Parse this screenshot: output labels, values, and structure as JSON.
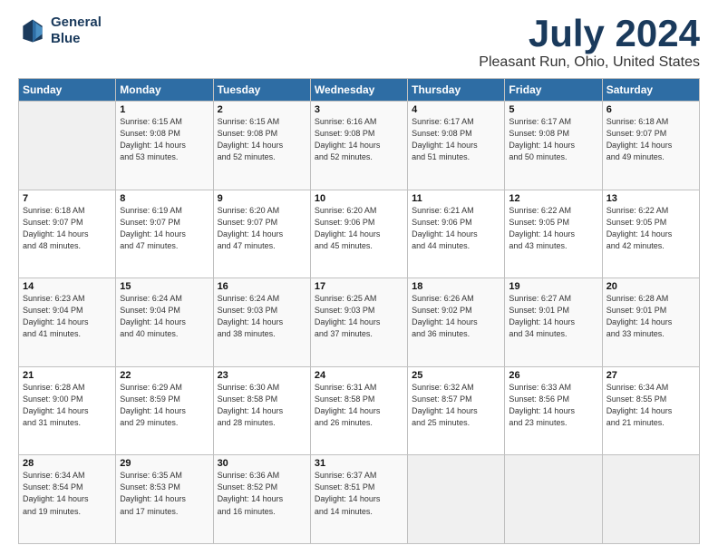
{
  "logo": {
    "line1": "General",
    "line2": "Blue"
  },
  "title": "July 2024",
  "location": "Pleasant Run, Ohio, United States",
  "days_of_week": [
    "Sunday",
    "Monday",
    "Tuesday",
    "Wednesday",
    "Thursday",
    "Friday",
    "Saturday"
  ],
  "weeks": [
    [
      {
        "day": "",
        "sunrise": "",
        "sunset": "",
        "daylight": ""
      },
      {
        "day": "1",
        "sunrise": "Sunrise: 6:15 AM",
        "sunset": "Sunset: 9:08 PM",
        "daylight": "Daylight: 14 hours and 53 minutes."
      },
      {
        "day": "2",
        "sunrise": "Sunrise: 6:15 AM",
        "sunset": "Sunset: 9:08 PM",
        "daylight": "Daylight: 14 hours and 52 minutes."
      },
      {
        "day": "3",
        "sunrise": "Sunrise: 6:16 AM",
        "sunset": "Sunset: 9:08 PM",
        "daylight": "Daylight: 14 hours and 52 minutes."
      },
      {
        "day": "4",
        "sunrise": "Sunrise: 6:17 AM",
        "sunset": "Sunset: 9:08 PM",
        "daylight": "Daylight: 14 hours and 51 minutes."
      },
      {
        "day": "5",
        "sunrise": "Sunrise: 6:17 AM",
        "sunset": "Sunset: 9:08 PM",
        "daylight": "Daylight: 14 hours and 50 minutes."
      },
      {
        "day": "6",
        "sunrise": "Sunrise: 6:18 AM",
        "sunset": "Sunset: 9:07 PM",
        "daylight": "Daylight: 14 hours and 49 minutes."
      }
    ],
    [
      {
        "day": "7",
        "sunrise": "Sunrise: 6:18 AM",
        "sunset": "Sunset: 9:07 PM",
        "daylight": "Daylight: 14 hours and 48 minutes."
      },
      {
        "day": "8",
        "sunrise": "Sunrise: 6:19 AM",
        "sunset": "Sunset: 9:07 PM",
        "daylight": "Daylight: 14 hours and 47 minutes."
      },
      {
        "day": "9",
        "sunrise": "Sunrise: 6:20 AM",
        "sunset": "Sunset: 9:07 PM",
        "daylight": "Daylight: 14 hours and 47 minutes."
      },
      {
        "day": "10",
        "sunrise": "Sunrise: 6:20 AM",
        "sunset": "Sunset: 9:06 PM",
        "daylight": "Daylight: 14 hours and 45 minutes."
      },
      {
        "day": "11",
        "sunrise": "Sunrise: 6:21 AM",
        "sunset": "Sunset: 9:06 PM",
        "daylight": "Daylight: 14 hours and 44 minutes."
      },
      {
        "day": "12",
        "sunrise": "Sunrise: 6:22 AM",
        "sunset": "Sunset: 9:05 PM",
        "daylight": "Daylight: 14 hours and 43 minutes."
      },
      {
        "day": "13",
        "sunrise": "Sunrise: 6:22 AM",
        "sunset": "Sunset: 9:05 PM",
        "daylight": "Daylight: 14 hours and 42 minutes."
      }
    ],
    [
      {
        "day": "14",
        "sunrise": "Sunrise: 6:23 AM",
        "sunset": "Sunset: 9:04 PM",
        "daylight": "Daylight: 14 hours and 41 minutes."
      },
      {
        "day": "15",
        "sunrise": "Sunrise: 6:24 AM",
        "sunset": "Sunset: 9:04 PM",
        "daylight": "Daylight: 14 hours and 40 minutes."
      },
      {
        "day": "16",
        "sunrise": "Sunrise: 6:24 AM",
        "sunset": "Sunset: 9:03 PM",
        "daylight": "Daylight: 14 hours and 38 minutes."
      },
      {
        "day": "17",
        "sunrise": "Sunrise: 6:25 AM",
        "sunset": "Sunset: 9:03 PM",
        "daylight": "Daylight: 14 hours and 37 minutes."
      },
      {
        "day": "18",
        "sunrise": "Sunrise: 6:26 AM",
        "sunset": "Sunset: 9:02 PM",
        "daylight": "Daylight: 14 hours and 36 minutes."
      },
      {
        "day": "19",
        "sunrise": "Sunrise: 6:27 AM",
        "sunset": "Sunset: 9:01 PM",
        "daylight": "Daylight: 14 hours and 34 minutes."
      },
      {
        "day": "20",
        "sunrise": "Sunrise: 6:28 AM",
        "sunset": "Sunset: 9:01 PM",
        "daylight": "Daylight: 14 hours and 33 minutes."
      }
    ],
    [
      {
        "day": "21",
        "sunrise": "Sunrise: 6:28 AM",
        "sunset": "Sunset: 9:00 PM",
        "daylight": "Daylight: 14 hours and 31 minutes."
      },
      {
        "day": "22",
        "sunrise": "Sunrise: 6:29 AM",
        "sunset": "Sunset: 8:59 PM",
        "daylight": "Daylight: 14 hours and 29 minutes."
      },
      {
        "day": "23",
        "sunrise": "Sunrise: 6:30 AM",
        "sunset": "Sunset: 8:58 PM",
        "daylight": "Daylight: 14 hours and 28 minutes."
      },
      {
        "day": "24",
        "sunrise": "Sunrise: 6:31 AM",
        "sunset": "Sunset: 8:58 PM",
        "daylight": "Daylight: 14 hours and 26 minutes."
      },
      {
        "day": "25",
        "sunrise": "Sunrise: 6:32 AM",
        "sunset": "Sunset: 8:57 PM",
        "daylight": "Daylight: 14 hours and 25 minutes."
      },
      {
        "day": "26",
        "sunrise": "Sunrise: 6:33 AM",
        "sunset": "Sunset: 8:56 PM",
        "daylight": "Daylight: 14 hours and 23 minutes."
      },
      {
        "day": "27",
        "sunrise": "Sunrise: 6:34 AM",
        "sunset": "Sunset: 8:55 PM",
        "daylight": "Daylight: 14 hours and 21 minutes."
      }
    ],
    [
      {
        "day": "28",
        "sunrise": "Sunrise: 6:34 AM",
        "sunset": "Sunset: 8:54 PM",
        "daylight": "Daylight: 14 hours and 19 minutes."
      },
      {
        "day": "29",
        "sunrise": "Sunrise: 6:35 AM",
        "sunset": "Sunset: 8:53 PM",
        "daylight": "Daylight: 14 hours and 17 minutes."
      },
      {
        "day": "30",
        "sunrise": "Sunrise: 6:36 AM",
        "sunset": "Sunset: 8:52 PM",
        "daylight": "Daylight: 14 hours and 16 minutes."
      },
      {
        "day": "31",
        "sunrise": "Sunrise: 6:37 AM",
        "sunset": "Sunset: 8:51 PM",
        "daylight": "Daylight: 14 hours and 14 minutes."
      },
      {
        "day": "",
        "sunrise": "",
        "sunset": "",
        "daylight": ""
      },
      {
        "day": "",
        "sunrise": "",
        "sunset": "",
        "daylight": ""
      },
      {
        "day": "",
        "sunrise": "",
        "sunset": "",
        "daylight": ""
      }
    ]
  ]
}
